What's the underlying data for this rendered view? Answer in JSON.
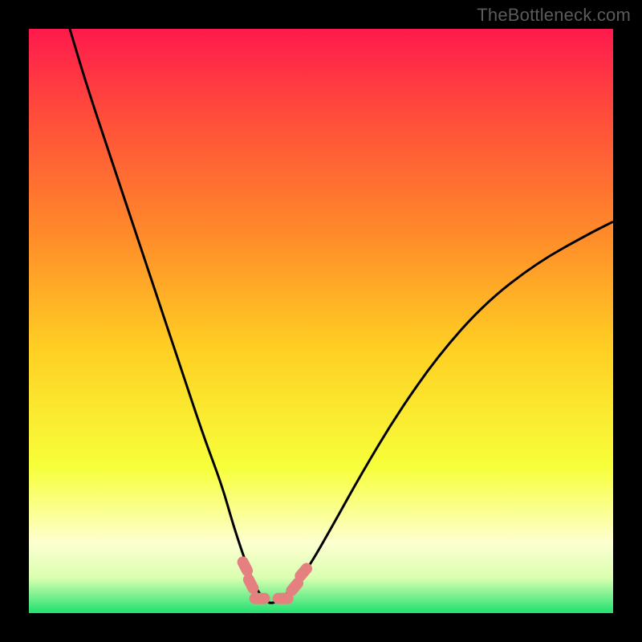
{
  "watermark": "TheBottleneck.com",
  "colors": {
    "frame": "#000000",
    "watermark_text": "#5b5b5b",
    "gradient_top": "#ff1a4d",
    "gradient_upper_mid": "#ff6a2b",
    "gradient_mid": "#ffd023",
    "gradient_lower_mid": "#f7ff3a",
    "gradient_pale": "#fdffd0",
    "gradient_bottom": "#20e070",
    "curve": "#000000",
    "marker": "#e58080"
  },
  "chart_data": {
    "type": "line",
    "title": "",
    "xlabel": "",
    "ylabel": "",
    "xlim": [
      0,
      100
    ],
    "ylim": [
      0,
      100
    ],
    "series": [
      {
        "name": "bottleneck-curve",
        "x": [
          7,
          10,
          14,
          18,
          22,
          26,
          30,
          33,
          35,
          37,
          38.5,
          40,
          41.5,
          43,
          45,
          48,
          52,
          57,
          63,
          70,
          78,
          87,
          96,
          100
        ],
        "y": [
          100,
          90,
          78,
          66,
          54,
          42,
          30,
          22,
          15,
          9,
          5,
          2.5,
          1.5,
          2.5,
          4,
          8,
          15,
          24,
          34,
          44,
          53,
          60,
          65,
          67
        ]
      }
    ],
    "markers": [
      {
        "name": "left-rounded-marker",
        "x": 37.0,
        "y": 8.0
      },
      {
        "name": "left-lower-marker",
        "x": 38.0,
        "y": 5.0
      },
      {
        "name": "trough-left-marker",
        "x": 39.5,
        "y": 2.5
      },
      {
        "name": "trough-right-marker",
        "x": 43.5,
        "y": 2.5
      },
      {
        "name": "right-lower-marker",
        "x": 45.5,
        "y": 4.5
      },
      {
        "name": "right-upper-marker",
        "x": 47.0,
        "y": 7.0
      }
    ],
    "gradient_stops": [
      {
        "pct": 0,
        "color": "#ff1a4d"
      },
      {
        "pct": 15,
        "color": "#ff4d3a"
      },
      {
        "pct": 35,
        "color": "#ff8a2a"
      },
      {
        "pct": 55,
        "color": "#ffd023"
      },
      {
        "pct": 75,
        "color": "#f7ff3a"
      },
      {
        "pct": 88,
        "color": "#fdffd0"
      },
      {
        "pct": 94,
        "color": "#d9ffb0"
      },
      {
        "pct": 100,
        "color": "#20e070"
      }
    ]
  }
}
